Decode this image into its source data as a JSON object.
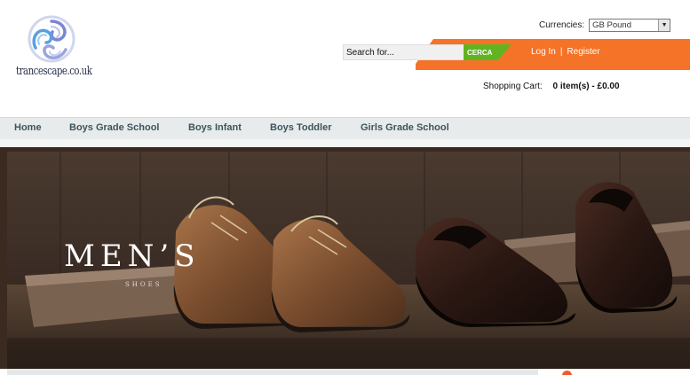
{
  "brand": {
    "logo_text": "trancescape.co.uk"
  },
  "currencies": {
    "label": "Currencies:",
    "selected": "GB Pound"
  },
  "search": {
    "placeholder": "Search for...",
    "button_label": "CERCA"
  },
  "account": {
    "login_label": "Log In",
    "separator": "|",
    "register_label": "Register"
  },
  "cart": {
    "label": "Shopping Cart:",
    "summary": "0 item(s) - £0.00"
  },
  "nav": {
    "items": [
      {
        "label": "Home"
      },
      {
        "label": "Boys Grade School"
      },
      {
        "label": "Boys Infant"
      },
      {
        "label": "Boys Toddler"
      },
      {
        "label": "Girls Grade School"
      }
    ]
  },
  "banner": {
    "title": "MEN’S",
    "subtitle": "SHOES"
  },
  "colors": {
    "accent_orange": "#f57328",
    "search_green": "#62b322",
    "nav_text": "#3a5560",
    "nav_bg": "#e8ebeb"
  }
}
